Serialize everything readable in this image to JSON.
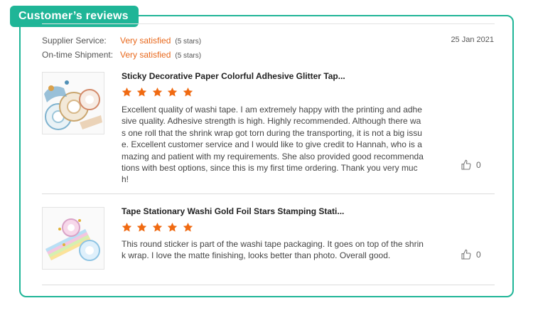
{
  "section": {
    "title": "Customer’s reviews"
  },
  "ratings": [
    {
      "label": "Supplier Service:",
      "value": "Very satisfied",
      "count": "(5 stars)"
    },
    {
      "label": "On-time Shipment:",
      "value": "Very satisfied",
      "count": "(5 stars)"
    }
  ],
  "date": "25 Jan 2021",
  "reviews": [
    {
      "product": "Sticky Decorative Paper Colorful Adhesive Glitter Tap...",
      "stars": 5,
      "text": "Excellent quality of washi tape. I am extremely happy with the printing and adhesive quality. Adhesive strength is high. Highly recommended. Although there was one roll that the shrink wrap got torn during the transporting, it is not a big issue. Excellent customer service and I would like to give credit to Hannah, who is amazing and patient with my requirements. She also provided good recommendations with best options, since this is my first time ordering. Thank you very much!",
      "likes": "0"
    },
    {
      "product": "Tape Stationary Washi Gold Foil Stars Stamping Stati...",
      "stars": 5,
      "text": "This round sticker is part of the washi tape packaging. It goes on top of the shrink wrap. I love the matte finishing, looks better than photo. Overall good.",
      "likes": "0"
    }
  ],
  "colors": {
    "accent": "#1fb597",
    "star": "#f06a12",
    "rating_text": "#e8681c"
  },
  "icons": {
    "star": "star-icon",
    "like": "thumbs-up-icon"
  }
}
